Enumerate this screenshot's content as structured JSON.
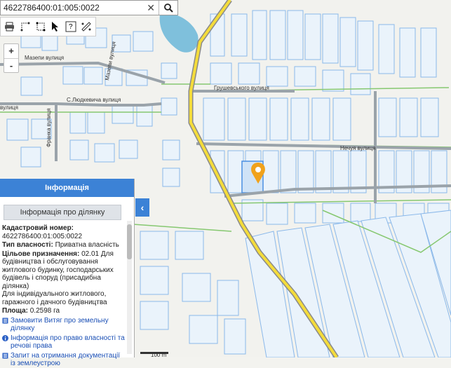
{
  "search": {
    "value": "4622786400:01:005:0022"
  },
  "toolbar": {
    "tools": [
      "print-icon",
      "measure-length-icon",
      "measure-area-icon",
      "pointer-icon",
      "identify-icon",
      "ruler-icon"
    ]
  },
  "zoom": {
    "in": "+",
    "out": "-"
  },
  "map": {
    "streets": [
      "Мазепи вулиця",
      "С.Людкевича вулиця",
      "Мазепи вулиця",
      "Грушевського вулиця",
      "Нечуя вулиця",
      "вулиця",
      "Франка вулиця"
    ],
    "scale_label": "100 m",
    "colors": {
      "parcel": "#8ab8ea",
      "parcel_fill": "#e9f2fb",
      "road": "#f4dc3a",
      "water": "#7fc0dc",
      "marker": "#f0a21c"
    }
  },
  "panel": {
    "header": "Інформація",
    "button": "Інформація про ділянку",
    "cadastral_label": "Кадастровий номер:",
    "cadastral_value": "4622786400:01:005:0022",
    "ownership_label": "Тип власності:",
    "ownership_value": "Приватна власність",
    "purpose_label": "Цільове призначення:",
    "purpose_value": "02.01 Для будівництва і обслуговування житлового будинку, господарських будівель і споруд (присадибна ділянка)",
    "purpose_extra": "Для індивідуального житлового, гаражного і дачного будівництва",
    "area_label": "Площа:",
    "area_value": "0.2598 га",
    "links": [
      "Замовити Витяг про земельну ділянку",
      "Інформація про право власності та речові права",
      "Запит на отримання документації із землеустрою"
    ],
    "collapse": "‹"
  }
}
